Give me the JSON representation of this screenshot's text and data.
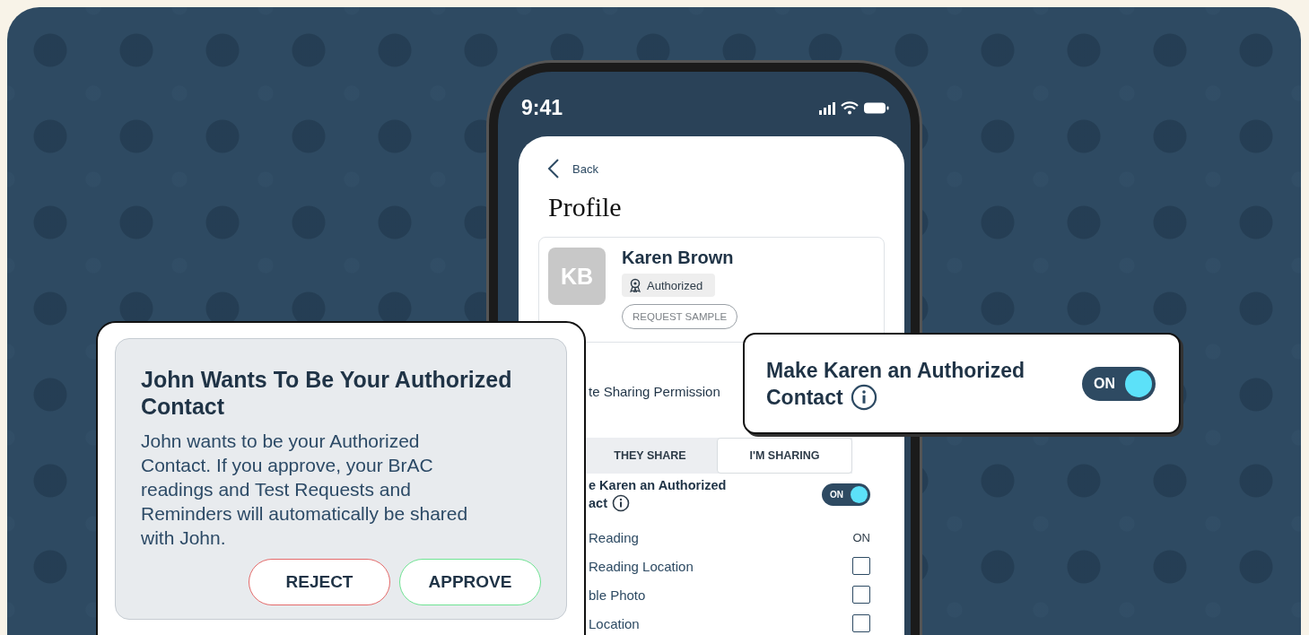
{
  "status_bar": {
    "time": "9:41"
  },
  "phone": {
    "back_label": "Back",
    "title": "Profile",
    "profile": {
      "initials": "KB",
      "name": "Karen Brown",
      "badge": "Authorized",
      "request_button": "REQUEST SAMPLE"
    },
    "section_heading": "te Sharing Permission",
    "tabs": [
      {
        "label": "THEY SHARE",
        "selected": false
      },
      {
        "label": "I'M SHARING",
        "selected": true
      }
    ],
    "authorized_toggle": {
      "label_lines": [
        "e Karen an Authorized",
        "act"
      ],
      "on": true,
      "state_label": "ON"
    },
    "permissions": [
      {
        "kind": "status",
        "label": "Reading",
        "status": "ON"
      },
      {
        "kind": "checkbox",
        "label": "Reading Location",
        "checked": false
      },
      {
        "kind": "checkbox",
        "label": "ble Photo",
        "checked": false
      },
      {
        "kind": "checkbox",
        "label": "Location",
        "checked": false
      }
    ]
  },
  "request_dialog": {
    "title": "John Wants To Be Your Authorized Contact",
    "body": "John wants to be your Authorized Contact. If you approve, your BrAC readings and Test Requests and Reminders will automatically be shared with John.",
    "buttons": [
      {
        "label": "REJECT",
        "kind": "reject"
      },
      {
        "label": "APPROVE",
        "kind": "approve"
      }
    ]
  },
  "callout": {
    "label_lines": [
      "Make Karen an Authorized",
      "Contact"
    ],
    "on": true,
    "state_label": "ON"
  }
}
